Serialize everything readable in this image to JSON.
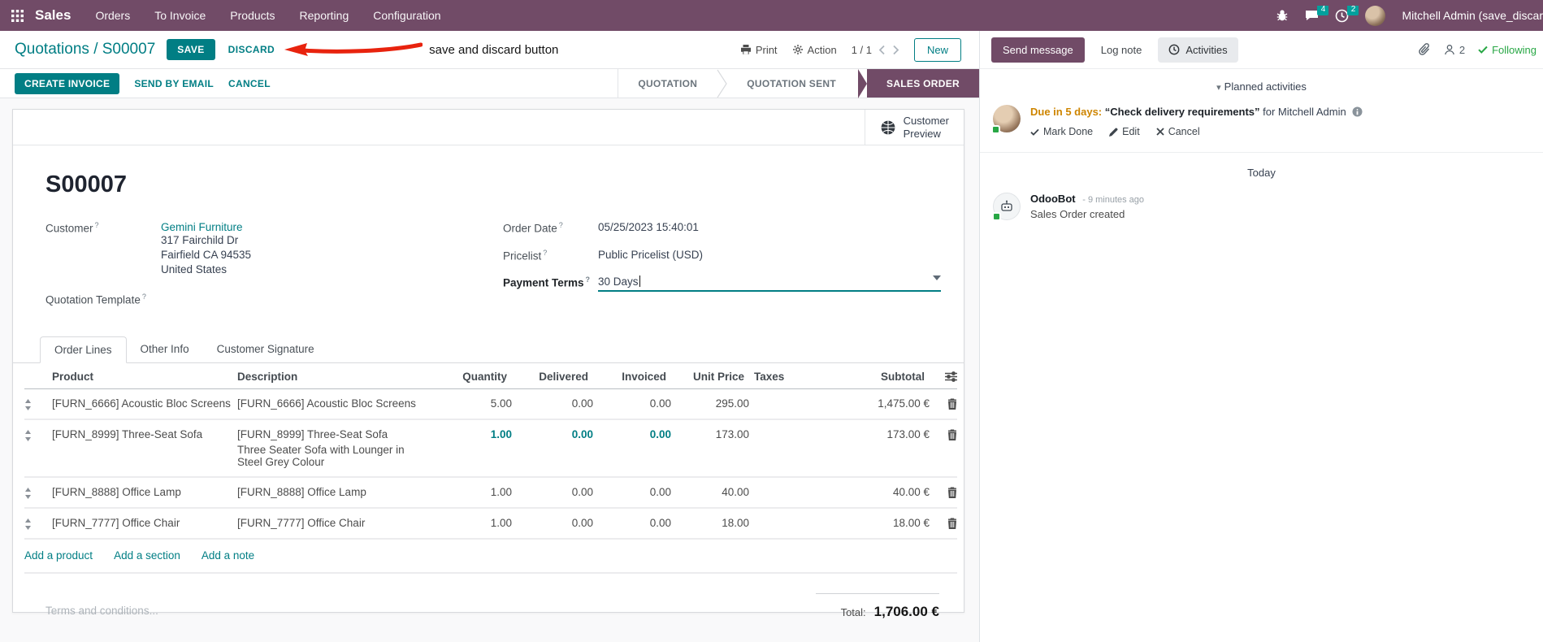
{
  "colors": {
    "brand": "#714B67",
    "accent": "#017E84",
    "badge": "#00A09D",
    "success": "#28a745",
    "warning": "#CE8500",
    "danger": "#E8230E"
  },
  "nav": {
    "app": "Sales",
    "items": [
      "Orders",
      "To Invoice",
      "Products",
      "Reporting",
      "Configuration"
    ],
    "messages_badge": "4",
    "activities_badge": "2",
    "user": "Mitchell Admin (save_discar"
  },
  "control": {
    "breadcrumb_parent": "Quotations",
    "breadcrumb_sep": "/",
    "record": "S00007",
    "save": "SAVE",
    "discard": "DISCARD",
    "annotation": "save and discard button",
    "print": "Print",
    "action": "Action",
    "pager": "1 / 1",
    "new": "New"
  },
  "statusbar": {
    "buttons": [
      "CREATE INVOICE",
      "SEND BY EMAIL",
      "CANCEL"
    ],
    "stages": [
      "QUOTATION",
      "QUOTATION SENT",
      "SALES ORDER"
    ],
    "active_stage": "SALES ORDER"
  },
  "form": {
    "preview_line1": "Customer",
    "preview_line2": "Preview",
    "reference": "S00007",
    "help_marker": "?",
    "customer": {
      "label": "Customer",
      "value": "Gemini Furniture",
      "address": [
        "317 Fairchild Dr",
        "Fairfield CA 94535",
        "United States"
      ]
    },
    "quotation_template_label": "Quotation Template",
    "order_date": {
      "label": "Order Date",
      "value": "05/25/2023 15:40:01"
    },
    "pricelist": {
      "label": "Pricelist",
      "value": "Public Pricelist (USD)"
    },
    "payment_terms": {
      "label": "Payment Terms",
      "value": "30 Days"
    }
  },
  "tabs": [
    {
      "label": "Order Lines"
    },
    {
      "label": "Other Info"
    },
    {
      "label": "Customer Signature"
    }
  ],
  "lines": {
    "headers": {
      "product": "Product",
      "description": "Description",
      "quantity": "Quantity",
      "delivered": "Delivered",
      "invoiced": "Invoiced",
      "unit_price": "Unit Price",
      "taxes": "Taxes",
      "subtotal": "Subtotal"
    },
    "rows": [
      {
        "product": "[FURN_6666] Acoustic Bloc Screens",
        "description": "[FURN_6666] Acoustic Bloc Screens",
        "description2": "",
        "quantity": "5.00",
        "delivered": "0.00",
        "invoiced": "0.00",
        "unit_price": "295.00",
        "taxes": "",
        "subtotal": "1,475.00 €"
      },
      {
        "product": "[FURN_8999] Three-Seat Sofa",
        "description": "[FURN_8999] Three-Seat Sofa",
        "description2": "Three Seater Sofa with Lounger in Steel Grey Colour",
        "quantity": "1.00",
        "delivered": "0.00",
        "invoiced": "0.00",
        "unit_price": "173.00",
        "taxes": "",
        "subtotal": "173.00 €"
      },
      {
        "product": "[FURN_8888] Office Lamp",
        "description": "[FURN_8888] Office Lamp",
        "description2": "",
        "quantity": "1.00",
        "delivered": "0.00",
        "invoiced": "0.00",
        "unit_price": "40.00",
        "taxes": "",
        "subtotal": "40.00 €"
      },
      {
        "product": "[FURN_7777] Office Chair",
        "description": "[FURN_7777] Office Chair",
        "description2": "",
        "quantity": "1.00",
        "delivered": "0.00",
        "invoiced": "0.00",
        "unit_price": "18.00",
        "taxes": "",
        "subtotal": "18.00 €"
      }
    ],
    "add_product": "Add a product",
    "add_section": "Add a section",
    "add_note": "Add a note",
    "total_label": "Total:",
    "total_value": "1,706.00 €",
    "terms_placeholder": "Terms and conditions..."
  },
  "chatter": {
    "send_message": "Send message",
    "log_note": "Log note",
    "activities": "Activities",
    "followers_count": "2",
    "following": "Following",
    "planned_header": "Planned activities",
    "activity": {
      "due": "Due in 5 days:",
      "summary": "“Check delivery requirements”",
      "assignee": "for Mitchell Admin",
      "mark_done": "Mark Done",
      "edit": "Edit",
      "cancel": "Cancel"
    },
    "date_divider": "Today",
    "message": {
      "author": "OdooBot",
      "time": "- 9 minutes ago",
      "body": "Sales Order created"
    }
  }
}
